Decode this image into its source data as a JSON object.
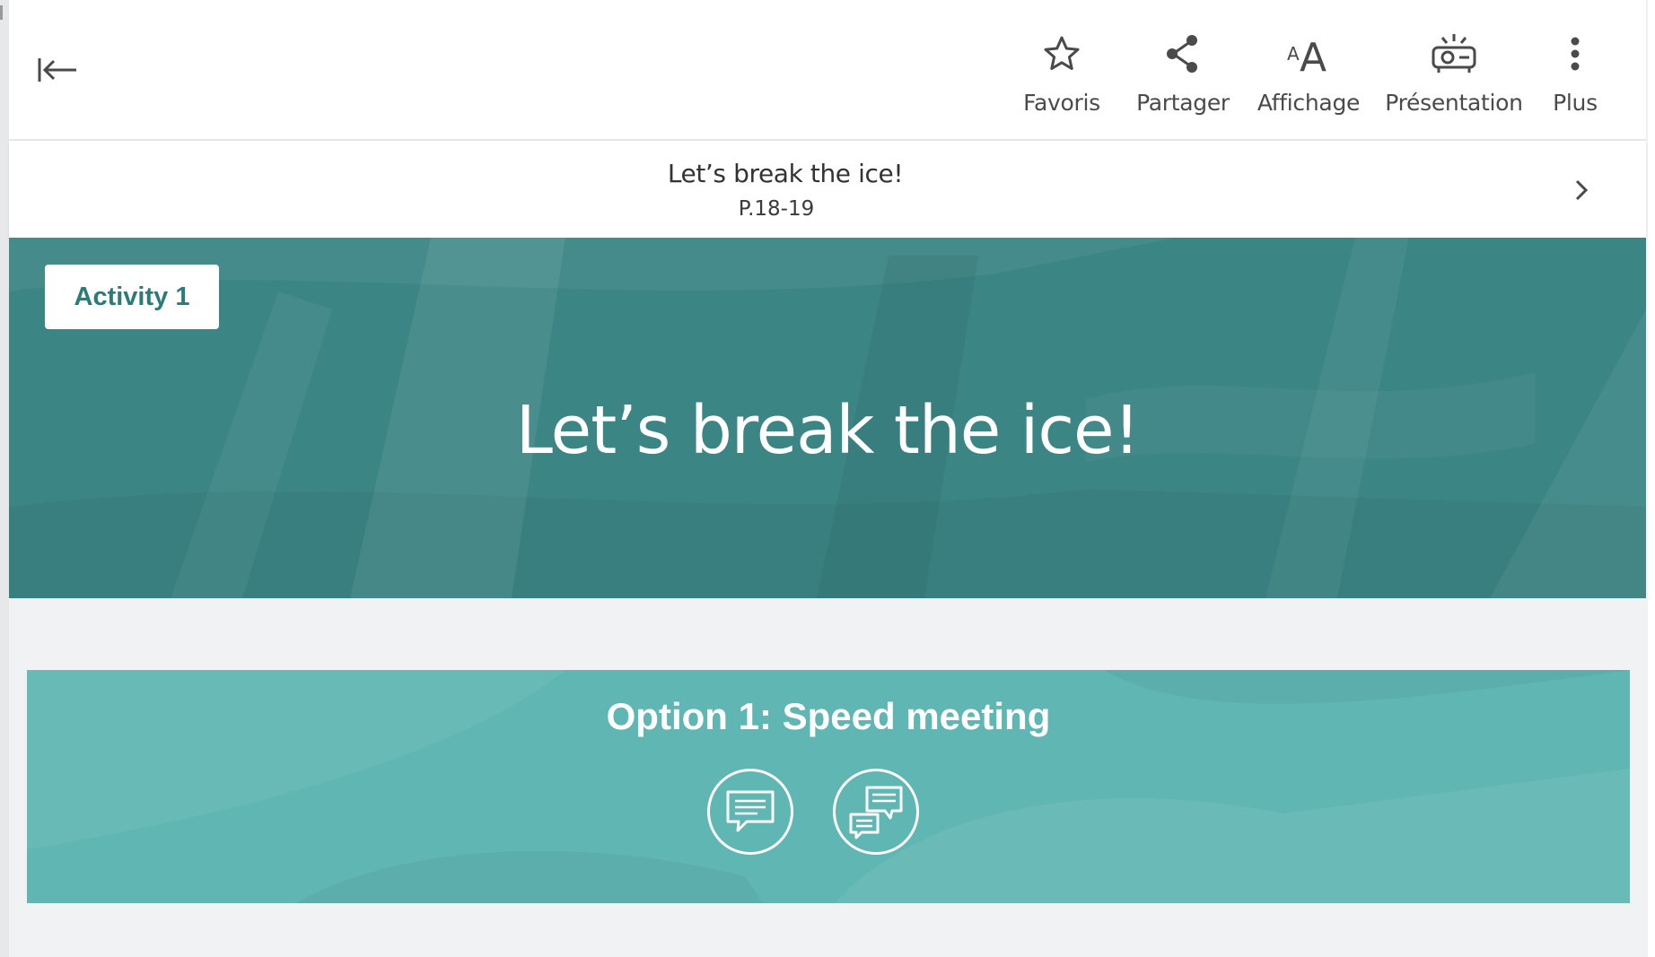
{
  "toolbar": {
    "back_icon": "arrow-to-left-icon",
    "tools": [
      {
        "id": "favorites",
        "label": "Favoris",
        "icon": "star-icon"
      },
      {
        "id": "share",
        "label": "Partager",
        "icon": "share-icon"
      },
      {
        "id": "display",
        "label": "Affichage",
        "icon": "font-size-icon"
      },
      {
        "id": "presentation",
        "label": "Présentation",
        "icon": "projector-icon"
      },
      {
        "id": "more",
        "label": "Plus",
        "icon": "more-vertical-icon"
      }
    ]
  },
  "subheader": {
    "title": "Let’s break the ice!",
    "pages": "P.18-19",
    "next_icon": "chevron-right-icon"
  },
  "hero": {
    "badge": "Activity 1",
    "title": "Let’s break the ice!",
    "color": "#3c8585"
  },
  "option": {
    "title": "Option 1: Speed meeting",
    "color": "#5fb6b3",
    "icons": [
      "single-speech-bubble-icon",
      "conversation-bubbles-icon"
    ]
  },
  "colors": {
    "accent": "#2c7b7b",
    "background": "#f1f2f4"
  }
}
